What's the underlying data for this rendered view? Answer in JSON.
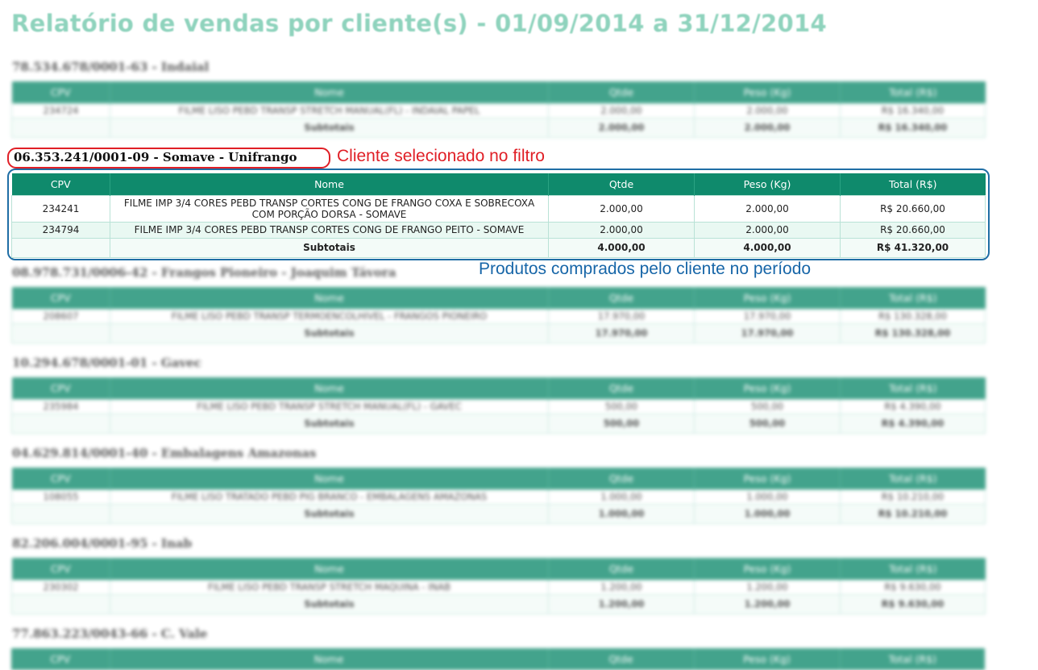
{
  "report": {
    "title": "Relatório de vendas por cliente(s) - 01/09/2014 a 31/12/2014"
  },
  "columns": {
    "cpv": "CPV",
    "nome": "Nome",
    "qtde": "Qtde",
    "peso": "Peso (Kg)",
    "total": "Total (R$)"
  },
  "subtotal_label": "Subtotais",
  "annotations": {
    "selected_client": "Cliente selecionado no filtro",
    "products_bought": "Produtos comprados pelo cliente no período"
  },
  "clients": [
    {
      "name": "78.534.678/0001-63 - Indaial",
      "rows": [
        {
          "cpv": "234724",
          "nome": "FILME LISO PEBD TRANSP STRETCH MANUAL(FL) - INDAIAL PAPEL",
          "qtde": "2.000,00",
          "peso": "2.000,00",
          "total": "R$ 16.340,00"
        }
      ],
      "sub": {
        "qtde": "2.000,00",
        "peso": "2.000,00",
        "total": "R$ 16.340,00"
      }
    },
    {
      "name": "06.353.241/0001-09 - Somave - Unifrango",
      "rows": [
        {
          "cpv": "234241",
          "nome": "FILME IMP 3/4 CORES PEBD TRANSP CORTES CONG DE FRANGO COXA E SOBRECOXA COM PORÇÃO DORSA - SOMAVE",
          "qtde": "2.000,00",
          "peso": "2.000,00",
          "total": "R$ 20.660,00"
        },
        {
          "cpv": "234794",
          "nome": "FILME IMP 3/4 CORES PEBD TRANSP CORTES CONG DE FRANGO PEITO - SOMAVE",
          "qtde": "2.000,00",
          "peso": "2.000,00",
          "total": "R$ 20.660,00"
        }
      ],
      "sub": {
        "qtde": "4.000,00",
        "peso": "4.000,00",
        "total": "R$ 41.320,00"
      }
    },
    {
      "name": "08.978.731/0006-42 - Frangos Pioneiro - Joaquim Távora",
      "rows": [
        {
          "cpv": "208607",
          "nome": "FILME LISO PEBD TRANSP TERMOENCOLHIVEL - FRANGOS PIONEIRO",
          "qtde": "17.970,00",
          "peso": "17.970,00",
          "total": "R$ 130.328,00"
        }
      ],
      "sub": {
        "qtde": "17.970,00",
        "peso": "17.970,00",
        "total": "R$ 130.328,00"
      }
    },
    {
      "name": "10.294.678/0001-01 - Gavec",
      "rows": [
        {
          "cpv": "235984",
          "nome": "FILME LISO PEBD TRANSP STRETCH MANUAL(FL) - GAVEC",
          "qtde": "500,00",
          "peso": "500,00",
          "total": "R$ 4.390,00"
        }
      ],
      "sub": {
        "qtde": "500,00",
        "peso": "500,00",
        "total": "R$ 4.390,00"
      }
    },
    {
      "name": "04.629.814/0001-40 - Embalagens Amazonas",
      "rows": [
        {
          "cpv": "108055",
          "nome": "FILME LISO TRATADO PEBD PIG BRANCO - EMBALAGENS AMAZONAS",
          "qtde": "1.000,00",
          "peso": "1.000,00",
          "total": "R$ 10.210,00"
        }
      ],
      "sub": {
        "qtde": "1.000,00",
        "peso": "1.000,00",
        "total": "R$ 10.210,00"
      }
    },
    {
      "name": "82.206.004/0001-95 - Inab",
      "rows": [
        {
          "cpv": "230302",
          "nome": "FILME LISO PEBD TRANSP STRETCH MAQUINA - INAB",
          "qtde": "1.200,00",
          "peso": "1.200,00",
          "total": "R$ 9.630,00"
        }
      ],
      "sub": {
        "qtde": "1.200,00",
        "peso": "1.200,00",
        "total": "R$ 9.630,00"
      }
    },
    {
      "name": "77.863.223/0043-66 - C. Vale",
      "rows": [],
      "sub": null
    }
  ]
}
